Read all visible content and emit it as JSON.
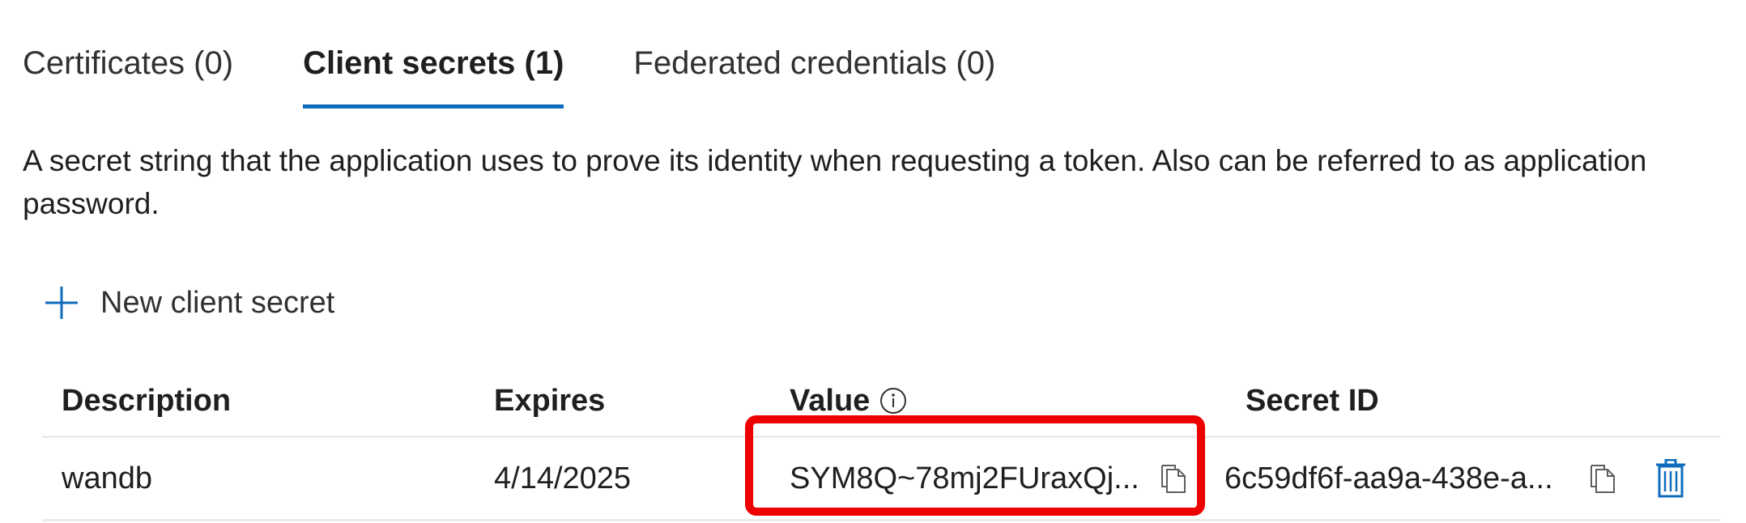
{
  "tabs": [
    {
      "label": "Certificates (0)",
      "active": false
    },
    {
      "label": "Client secrets (1)",
      "active": true
    },
    {
      "label": "Federated credentials (0)",
      "active": false
    }
  ],
  "description": "A secret string that the application uses to prove its identity when requesting a token. Also can be referred to as application password.",
  "new_secret": {
    "label": "New client secret",
    "icon": "plus-icon"
  },
  "table": {
    "headers": {
      "description": "Description",
      "expires": "Expires",
      "value": "Value",
      "secret_id": "Secret ID"
    },
    "rows": [
      {
        "description": "wandb",
        "expires": "4/14/2025",
        "value": "SYM8Q~78mj2FUraxQj...",
        "secret_id": "6c59df6f-aa9a-438e-a..."
      }
    ]
  },
  "colors": {
    "accent": "#0f6cbd",
    "highlight": "#ec0000"
  }
}
